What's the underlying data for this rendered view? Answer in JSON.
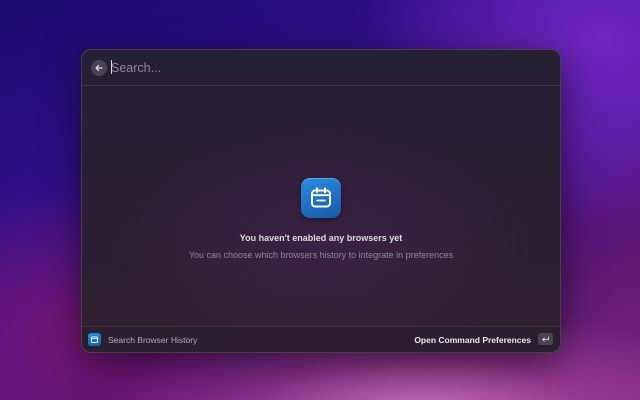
{
  "search": {
    "placeholder": "Search...",
    "value": ""
  },
  "empty_state": {
    "icon": "calendar-icon",
    "title": "You haven't enabled any browsers yet",
    "subtitle": "You can choose which browsers history to integrate in preferences"
  },
  "footer": {
    "command_icon": "calendar-icon",
    "command_name": "Search Browser History",
    "action_label": "Open Command Preferences",
    "action_key": "return-key-icon"
  },
  "colors": {
    "accent": "#1f6fc2",
    "window_bg": "#2a1f33"
  }
}
